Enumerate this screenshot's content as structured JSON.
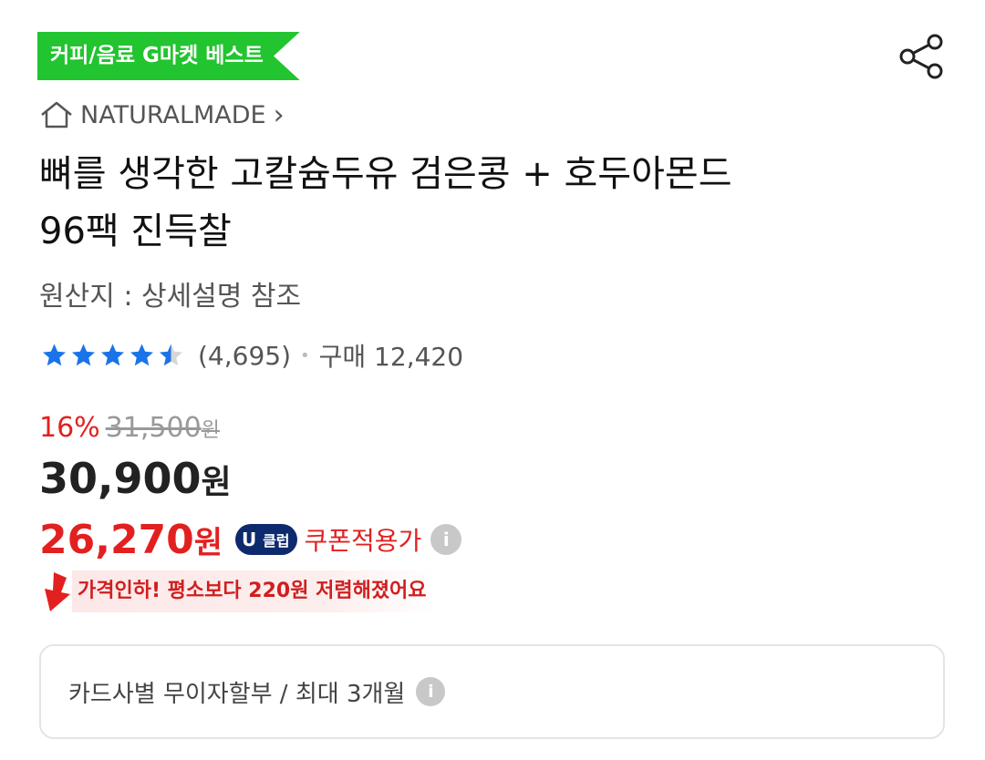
{
  "badge": {
    "label": "커피/음료 G마켓 베스트",
    "color": "#22c42f"
  },
  "share": {
    "icon": "share-icon"
  },
  "brand": {
    "icon": "home-icon",
    "name": "NATURALMADE",
    "chevron": "›"
  },
  "product": {
    "title_line1": "뼈를 생각한 고칼슘두유 검은콩 + 호두아몬드",
    "title_line2": "96팩 진득찰",
    "origin": "원산지 : 상세설명 참조"
  },
  "rating": {
    "stars": 4.5,
    "star_color": "#1a73e8",
    "review_count": "(4,695)",
    "purchase_label": "구매 12,420"
  },
  "price": {
    "discount_rate": "16%",
    "original_price": "31,500",
    "original_unit": "원",
    "sale_price": "30,900",
    "sale_unit": "원",
    "coupon_price": "26,270",
    "coupon_unit": "원",
    "uclub_u": "U",
    "uclub_label": "클럽",
    "coupon_label": "쿠폰적용가",
    "info_icon": "i",
    "accent_color": "#e32020"
  },
  "price_drop": {
    "icon": "down-arrow-icon",
    "text": "가격인하! 평소보다 220원 저렴해졌어요"
  },
  "installment": {
    "text": "카드사별 무이자할부 / 최대 3개월",
    "info_icon": "i"
  }
}
